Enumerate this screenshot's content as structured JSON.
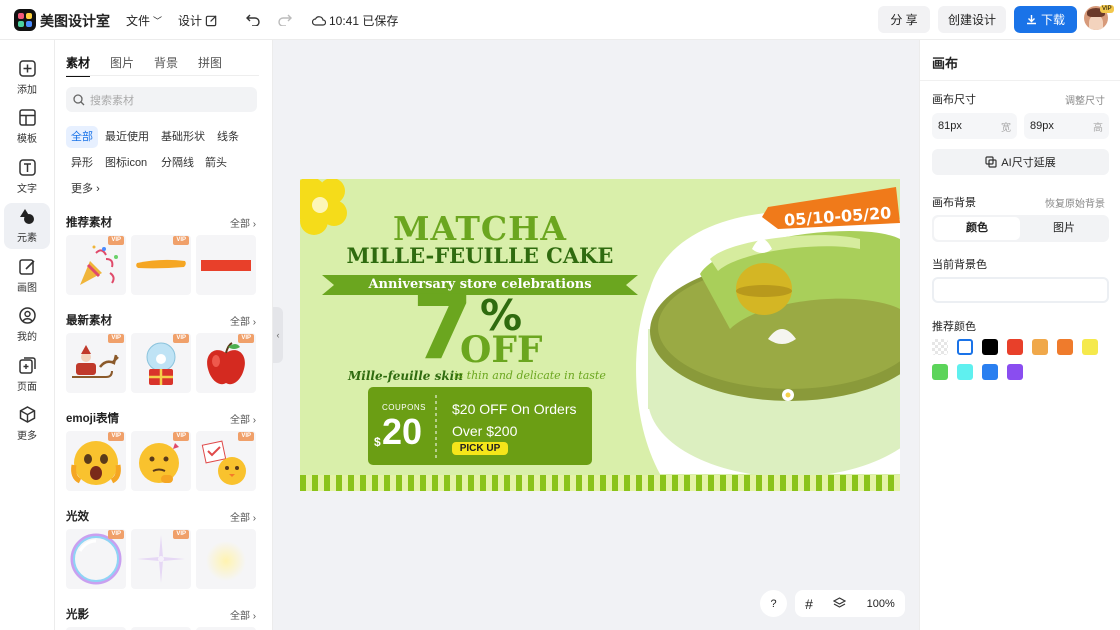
{
  "app": {
    "name": "美图设计室"
  },
  "topbar": {
    "file_label": "文件",
    "design_label": "设计",
    "save_status": "10:41 已保存",
    "share_label": "分 享",
    "create_label": "创建设计",
    "download_label": "下载",
    "avatar_badge": "VIP"
  },
  "rail": {
    "items": [
      {
        "label": "添加",
        "icon": "plus-square-icon"
      },
      {
        "label": "模板",
        "icon": "layout-icon"
      },
      {
        "label": "文字",
        "icon": "text-icon"
      },
      {
        "label": "元素",
        "icon": "shapes-icon"
      },
      {
        "label": "画图",
        "icon": "pencil-icon"
      },
      {
        "label": "我的",
        "icon": "user-icon"
      },
      {
        "label": "页面",
        "icon": "add-page-icon"
      },
      {
        "label": "更多",
        "icon": "cube-icon"
      }
    ]
  },
  "panel": {
    "tabs": [
      "素材",
      "图片",
      "背景",
      "拼图"
    ],
    "search_placeholder": "搜索素材",
    "chips": [
      "全部",
      "最近使用",
      "基础形状",
      "线条",
      "异形",
      "图标icon",
      "分隔线",
      "箭头",
      "更多"
    ],
    "all_label": "全部",
    "vip": "VIP",
    "sections": [
      {
        "title": "推荐素材"
      },
      {
        "title": "最新素材"
      },
      {
        "title": "emoji表情"
      },
      {
        "title": "光效"
      },
      {
        "title": "光影"
      }
    ]
  },
  "design": {
    "title1": "MATCHA",
    "title2": "MILLE-FEUILLE CAKE",
    "ribbon": "Anniversary store celebrations",
    "percent": "7",
    "percent_sign": "%",
    "off": "OFF",
    "tagline_script": "Mille-feuille skin",
    "tagline": "is thin and delicate in taste",
    "date": "05/10-05/20",
    "coupon_label": "COUPONS",
    "coupon_currency": "$",
    "coupon_value": "20",
    "coupon_line1": "$20 OFF On Orders",
    "coupon_line2": "Over $200",
    "coupon_cta": "PICK UP"
  },
  "right": {
    "title": "画布",
    "size_label": "画布尺寸",
    "resize_link": "调整尺寸",
    "width_value": "81px",
    "width_unit": "宽",
    "height_value": "89px",
    "height_unit": "高",
    "ai_button": "AI尺寸延展",
    "bg_label": "画布背景",
    "restore_link": "恢复原始背景",
    "bg_tab_color": "颜色",
    "bg_tab_image": "图片",
    "current_bg_label": "当前背景色",
    "recommend_label": "推荐颜色",
    "colors": [
      "transparent",
      "#ffffff",
      "#000000",
      "#e8402a",
      "#f0a84a",
      "#ef7b2c",
      "#f5e94c",
      "#5cd45a",
      "#5ff0ef",
      "#2a7ff0",
      "#8a4df0"
    ]
  },
  "bottom": {
    "help": "?",
    "zoom": "100%"
  }
}
